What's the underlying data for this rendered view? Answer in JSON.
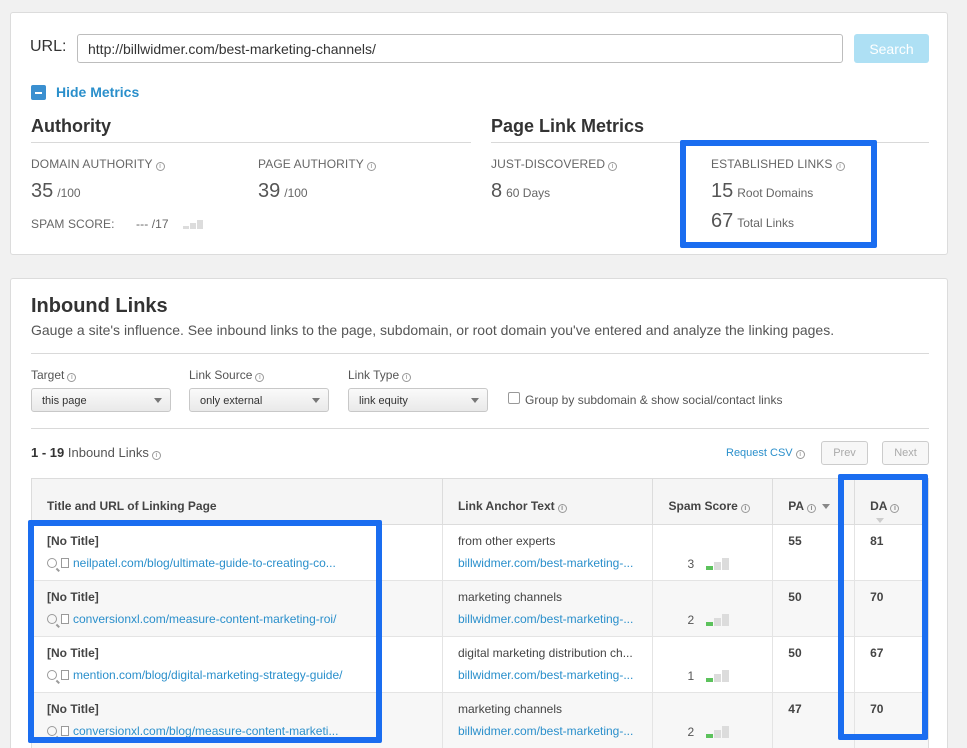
{
  "search": {
    "label": "URL:",
    "value": "http://billwidmer.com/best-marketing-channels/",
    "button": "Search"
  },
  "metrics_toggle": "Hide Metrics",
  "authority": {
    "title": "Authority",
    "domain_authority": {
      "label": "DOMAIN AUTHORITY",
      "value": "35",
      "unit": "/100"
    },
    "page_authority": {
      "label": "PAGE AUTHORITY",
      "value": "39",
      "unit": "/100"
    },
    "spam_score": {
      "label": "SPAM SCORE:",
      "value": "--- /17"
    }
  },
  "page_link_metrics": {
    "title": "Page Link Metrics",
    "just_discovered": {
      "label": "JUST-DISCOVERED",
      "value": "8",
      "unit": "60 Days"
    },
    "established": {
      "label": "ESTABLISHED LINKS",
      "root_domains_value": "15",
      "root_domains_unit": "Root Domains",
      "total_links_value": "67",
      "total_links_unit": "Total Links"
    }
  },
  "inbound": {
    "title": "Inbound Links",
    "description": "Gauge a site's influence. See inbound links to the page, subdomain, or root domain you've entered and analyze the linking pages.",
    "filters": {
      "target": {
        "label": "Target",
        "selected": "this page"
      },
      "link_source": {
        "label": "Link Source",
        "selected": "only external"
      },
      "link_type": {
        "label": "Link Type",
        "selected": "link equity"
      },
      "group_checkbox": "Group by subdomain & show social/contact links"
    },
    "count_range": "1 - 19",
    "count_suffix": "Inbound Links",
    "request_csv": "Request CSV",
    "prev": "Prev",
    "next": "Next",
    "columns": {
      "title_url": "Title and URL of Linking Page",
      "anchor": "Link Anchor Text",
      "spam": "Spam Score",
      "pa": "PA",
      "da": "DA"
    },
    "rows": [
      {
        "title": "[No Title]",
        "url": "neilpatel.com/blog/ultimate-guide-to-creating-co...",
        "anchor": "from other experts",
        "anchor_url": "billwidmer.com/best-marketing-...",
        "spam": "3",
        "pa": "55",
        "da": "81"
      },
      {
        "title": "[No Title]",
        "url": "conversionxl.com/measure-content-marketing-roi/",
        "anchor": "marketing channels",
        "anchor_url": "billwidmer.com/best-marketing-...",
        "spam": "2",
        "pa": "50",
        "da": "70"
      },
      {
        "title": "[No Title]",
        "url": "mention.com/blog/digital-marketing-strategy-guide/",
        "anchor": "digital marketing distribution ch...",
        "anchor_url": "billwidmer.com/best-marketing-...",
        "spam": "1",
        "pa": "50",
        "da": "67"
      },
      {
        "title": "[No Title]",
        "url": "conversionxl.com/blog/measure-content-marketi...",
        "anchor": "marketing channels",
        "anchor_url": "billwidmer.com/best-marketing-...",
        "spam": "2",
        "pa": "47",
        "da": "70"
      }
    ]
  },
  "colors": {
    "accent": "#2a8fcb",
    "highlight": "#1a6df0",
    "spam_low": "#5cc25c"
  }
}
